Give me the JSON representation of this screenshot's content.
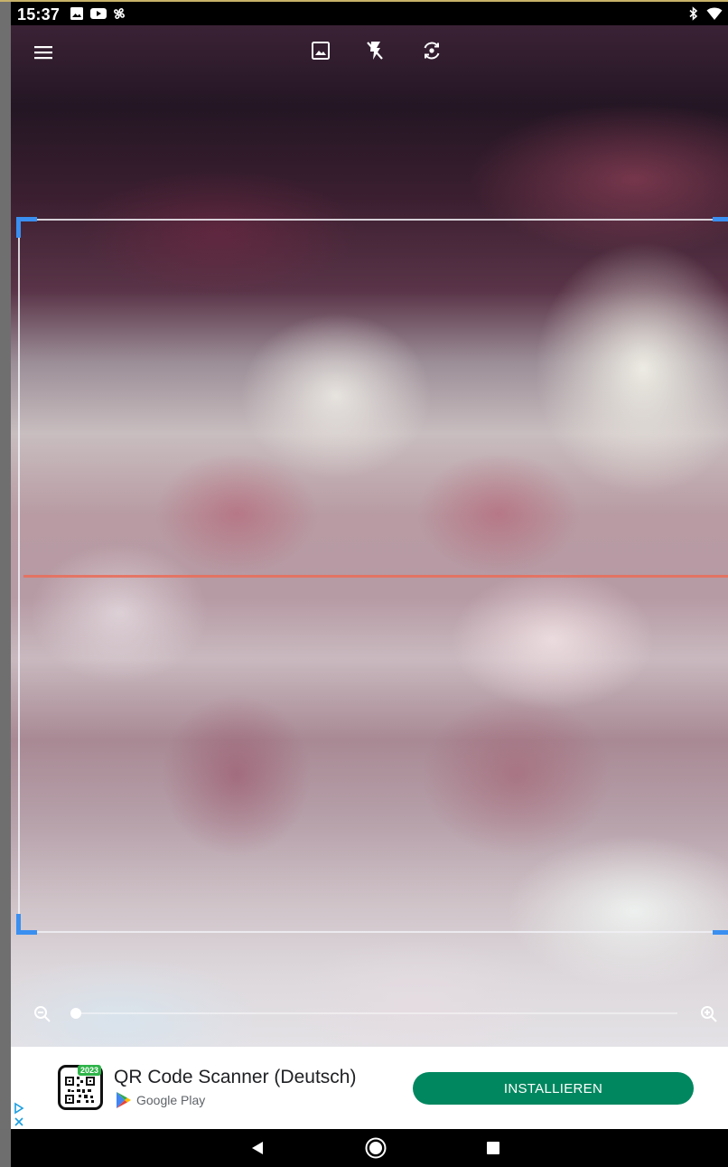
{
  "status_bar": {
    "time": "15:37",
    "left_icons": [
      "image-icon",
      "youtube-icon",
      "pinwheel-icon"
    ],
    "right_icons": [
      "bluetooth-icon",
      "wifi-icon"
    ]
  },
  "toolbar": {
    "menu_icon": "menu-icon",
    "gallery_icon": "image-icon",
    "flash_icon": "flash-off-icon",
    "camera_switch_icon": "camera-switch-icon"
  },
  "scanner": {
    "frame_corner_color": "#3a8ff0",
    "laser_color": "#e86f5d",
    "zoom_level": 0
  },
  "ad": {
    "app_badge": "2023",
    "title": "QR Code Scanner (Deutsch)",
    "store": "Google Play",
    "install_label": "INSTALLIEREN",
    "button_color": "#01875f"
  },
  "nav_bar": {
    "icons": [
      "back-icon",
      "home-icon",
      "recents-icon"
    ]
  }
}
